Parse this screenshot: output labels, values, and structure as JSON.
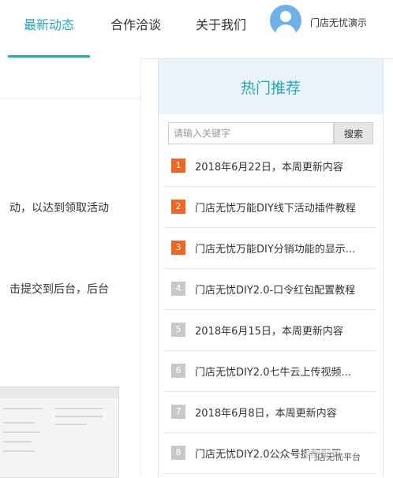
{
  "nav": {
    "tabs": [
      {
        "label": "最新动态",
        "active": true
      },
      {
        "label": "合作洽谈",
        "active": false
      },
      {
        "label": "关于我们",
        "active": false
      }
    ],
    "user_name": "门店无忧演示",
    "accent_color": "#2aa6b5"
  },
  "article": {
    "line1": "动，以达到领取活动",
    "line2": "击提交到后台，后台"
  },
  "sidebar": {
    "title": "热门推荐",
    "search_placeholder": "请输入关键字",
    "search_button": "搜索",
    "items": [
      {
        "num": "1",
        "text": "2018年6月22日，本周更新内容",
        "hot": true
      },
      {
        "num": "2",
        "text": "门店无忧万能DIY线下活动插件教程",
        "hot": true
      },
      {
        "num": "3",
        "text": "门店无忧万能DIY分销功能的显示...",
        "hot": true
      },
      {
        "num": "4",
        "text": "门店无忧DIY2.0-口令红包配置教程",
        "hot": false
      },
      {
        "num": "5",
        "text": "2018年6月15日，本周更新内容",
        "hot": false
      },
      {
        "num": "6",
        "text": "门店无忧DIY2.0七牛云上传视频...",
        "hot": false
      },
      {
        "num": "7",
        "text": "2018年6月8日，本周更新内容",
        "hot": false
      },
      {
        "num": "8",
        "text": "门店无忧DIY2.0公众号提醒配置...",
        "hot": false
      }
    ]
  },
  "watermark": "门店无忧平台"
}
